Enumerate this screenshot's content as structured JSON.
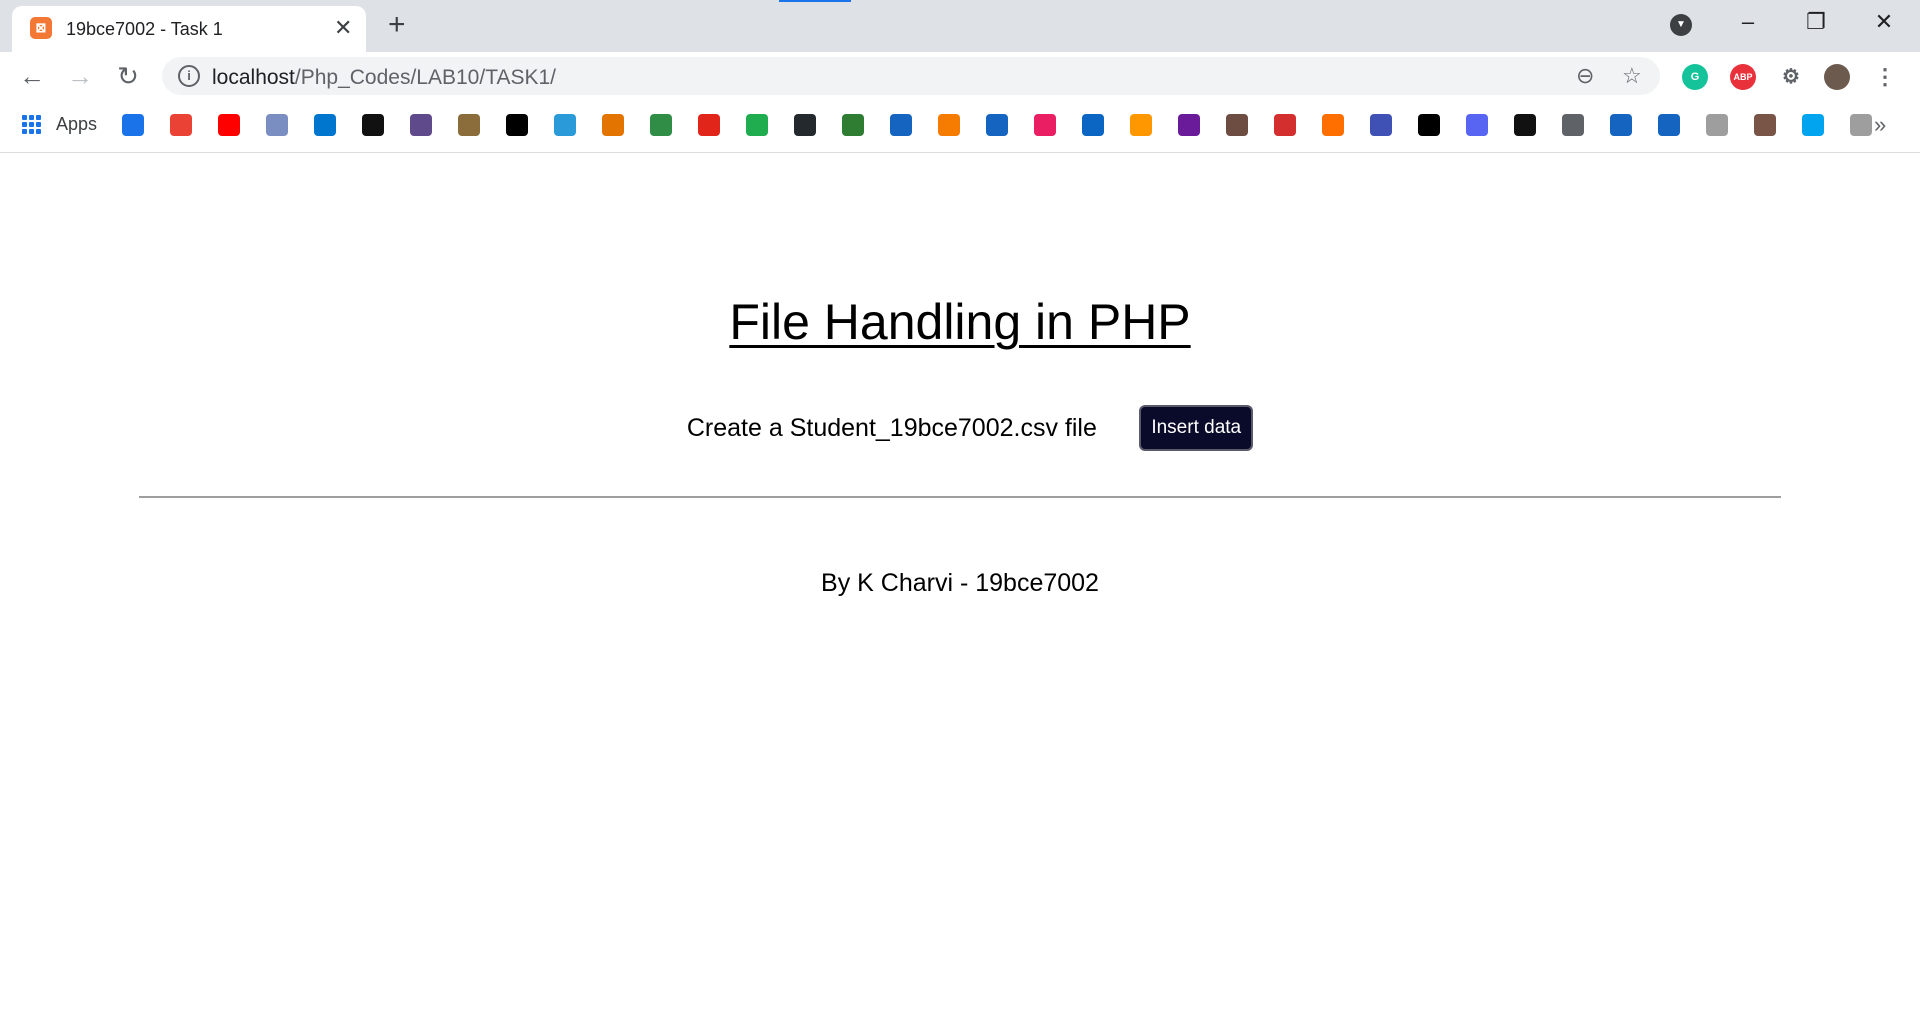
{
  "browser": {
    "tab_title": "19bce7002 - Task 1",
    "url_host": "localhost",
    "url_path": "/Php_Codes/LAB10/TASK1/",
    "apps_label": "Apps",
    "extensions": [
      {
        "name": "grammarly",
        "label": "G",
        "color": "#15c39a"
      },
      {
        "name": "adblock",
        "label": "ABP",
        "color": "#e8313a"
      }
    ],
    "bookmark_colors": [
      "#1a73e8",
      "#ea4335",
      "#ff0000",
      "#7b8ec2",
      "#0076ce",
      "#111111",
      "#5f4b8b",
      "#8a6d3b",
      "#000000",
      "#2a9bd8",
      "#e37400",
      "#2f8d46",
      "#e1251b",
      "#1fad4f",
      "#24292e",
      "#2e7d32",
      "#1565c0",
      "#f57c00",
      "#1565c0",
      "#e91e63",
      "#0a66c2",
      "#ff9800",
      "#6a1b9a",
      "#6d4c41",
      "#d32f2f",
      "#ff6f00",
      "#3f51b5",
      "#000000",
      "#5865f2",
      "#111111",
      "#5f6368",
      "#1565c0",
      "#1565c0",
      "#9e9e9e",
      "#795548",
      "#00a4ef",
      "#9e9e9e"
    ]
  },
  "page": {
    "heading": "File Handling in PHP",
    "create_label": "Create a Student_19bce7002.csv file",
    "insert_button": "Insert data",
    "footer": "By K Charvi - 19bce7002"
  }
}
